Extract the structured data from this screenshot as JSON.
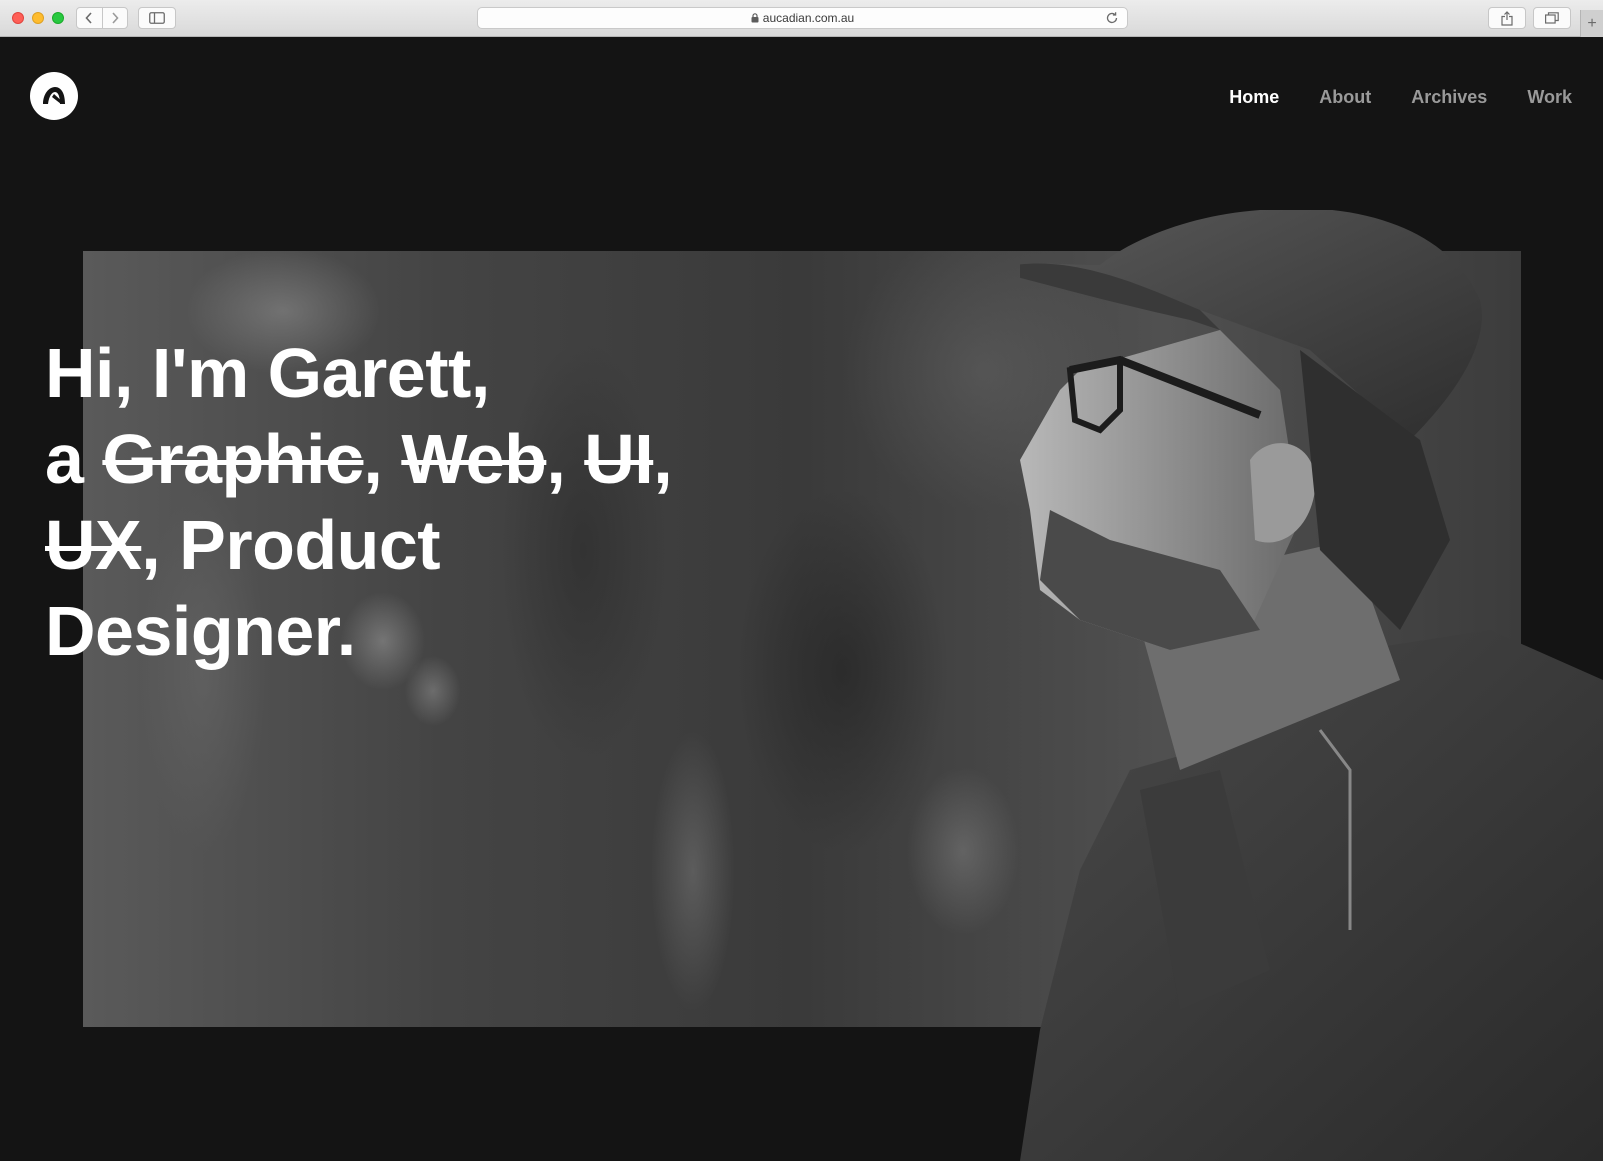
{
  "browser": {
    "url": "aucadian.com.au"
  },
  "site": {
    "logo_icon": "aucadian-logo-icon",
    "nav": [
      {
        "label": "Home",
        "active": true
      },
      {
        "label": "About",
        "active": false
      },
      {
        "label": "Archives",
        "active": false
      },
      {
        "label": "Work",
        "active": false
      }
    ]
  },
  "hero": {
    "line1": "Hi, I'm Garett,",
    "line2_prefix": "a ",
    "struck_graphic": "Graphic",
    "sep1": ", ",
    "struck_web": "Web",
    "sep2": ", ",
    "struck_ui": "UI",
    "sep3": ",",
    "struck_ux": "UX",
    "line3_rest": ", Product",
    "line4": "Designer."
  },
  "colors": {
    "background": "#141414",
    "nav_active": "#ffffff",
    "nav_inactive": "#9a9a9a"
  }
}
